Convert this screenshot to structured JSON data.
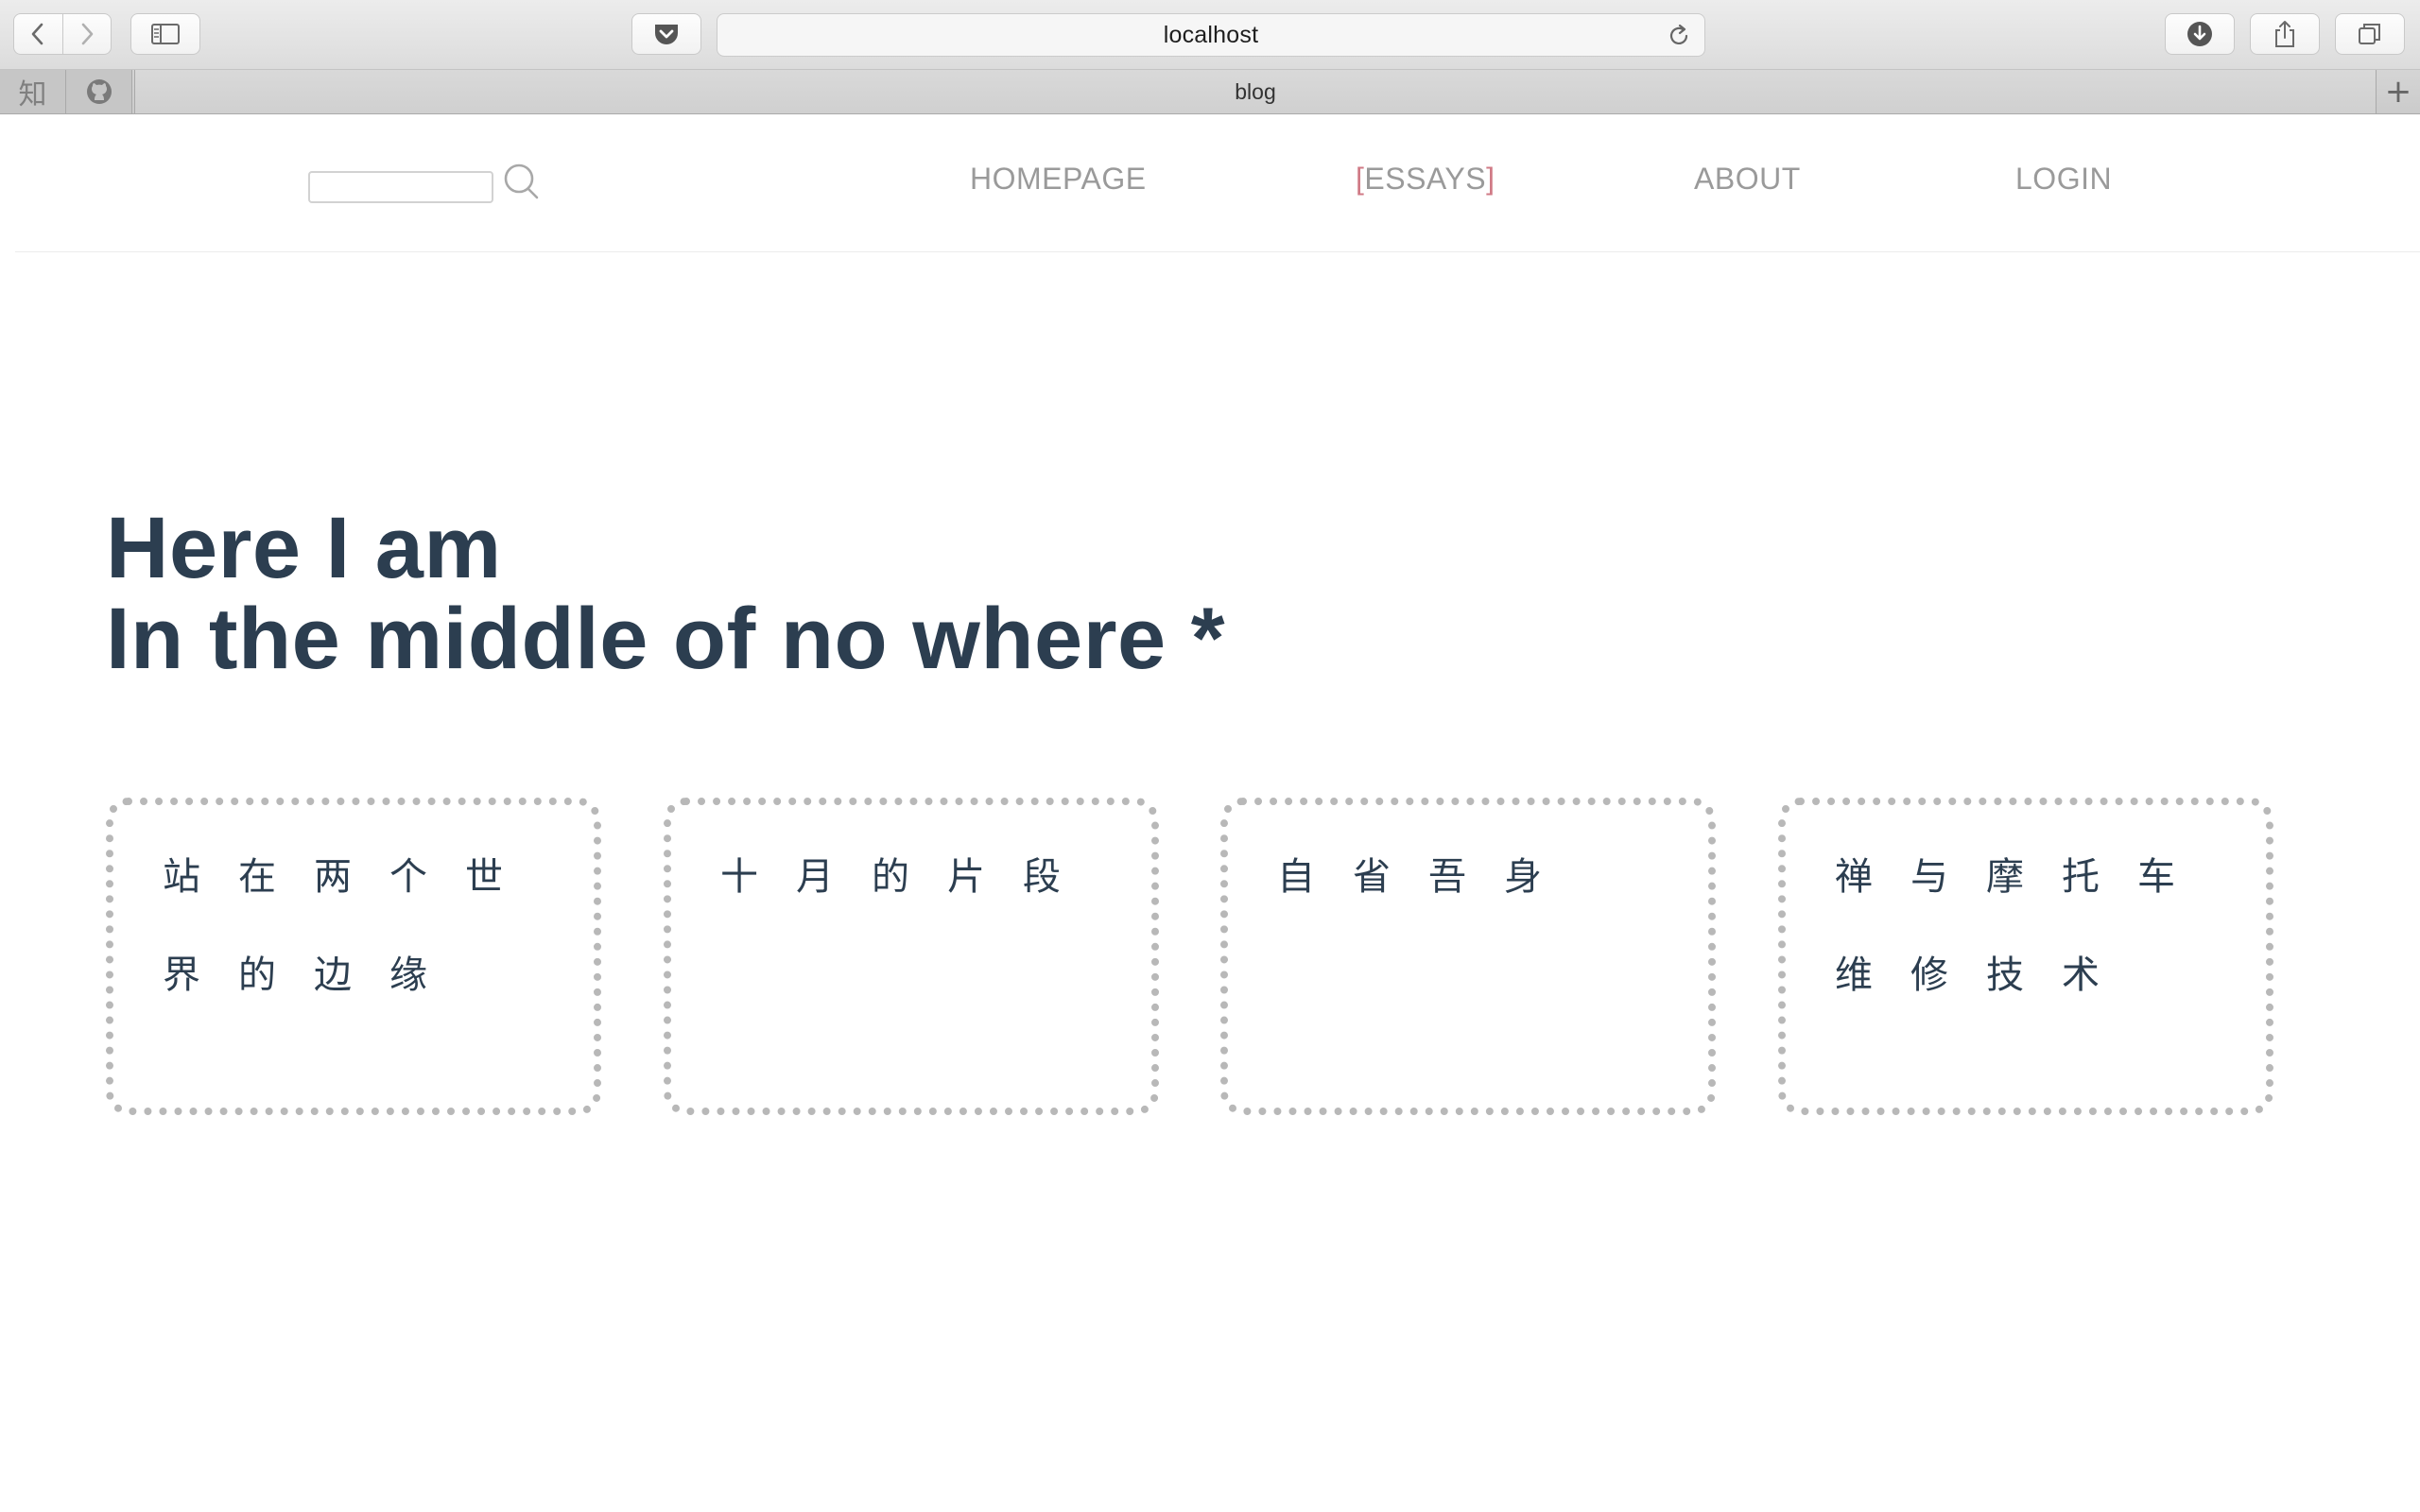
{
  "browser": {
    "address": "localhost",
    "active_tab": "blog",
    "pinned_tabs": [
      {
        "label": "知",
        "icon": "zhihu-icon"
      },
      {
        "label": "",
        "icon": "github-icon"
      }
    ],
    "new_tab_label": "+"
  },
  "site": {
    "search": {
      "value": "",
      "placeholder": ""
    },
    "nav": {
      "homepage": "HOMEPAGE",
      "essays_open": "[",
      "essays": "ESSAYS",
      "essays_close": "]",
      "about": "ABOUT",
      "login": "LOGIN"
    },
    "hero": {
      "line1": "Here I am",
      "line2": "In the middle of no where *"
    },
    "cards": [
      {
        "title": "站在两个世界的边缘"
      },
      {
        "title": "十月的片段"
      },
      {
        "title": "自省吾身"
      },
      {
        "title": "禅与摩托车维修技术"
      }
    ]
  },
  "colors": {
    "heading": "#2c3e50",
    "nav": "#9a9a9a",
    "nav_active_bracket": "#d07a86",
    "card_border": "#b8b8b8"
  }
}
